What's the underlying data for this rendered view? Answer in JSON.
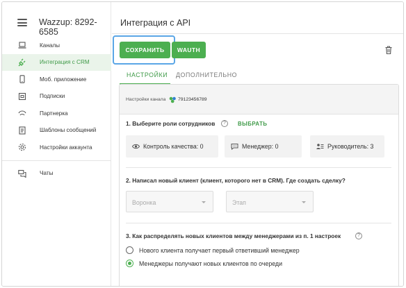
{
  "sidebar": {
    "title": "Wazzup: 8292-6585",
    "items": [
      {
        "label": "Каналы",
        "icon": "laptop-icon"
      },
      {
        "label": "Интеграция с CRM",
        "icon": "plug-icon",
        "active": true
      },
      {
        "label": "Моб. приложение",
        "icon": "phone-icon"
      },
      {
        "label": "Подписки",
        "icon": "wallet-icon"
      },
      {
        "label": "Партнерка",
        "icon": "handshake-icon"
      },
      {
        "label": "Шаблоны сообщений",
        "icon": "document-icon"
      },
      {
        "label": "Настройки аккаунта",
        "icon": "gear-icon"
      }
    ],
    "chats_label": "Чаты"
  },
  "main": {
    "title": "Интеграция с API",
    "toolbar": {
      "save_label": "СОХРАНИТЬ",
      "wauth_label": "WAUTH"
    },
    "tabs": [
      {
        "label": "НАСТРОЙКИ",
        "active": true
      },
      {
        "label": "ДОПОЛНИТЕЛЬНО",
        "active": false
      }
    ],
    "channel": {
      "label": "Настройки канала",
      "phone": "79123456789"
    },
    "section1": {
      "title": "1. Выберите роли сотрудников",
      "select_label": "ВЫБРАТЬ",
      "roles": [
        {
          "label": "Контроль качества: 0",
          "icon": "eye-icon"
        },
        {
          "label": "Менеджер: 0",
          "icon": "chat-icon"
        },
        {
          "label": "Руководитель: 3",
          "icon": "team-icon"
        }
      ]
    },
    "section2": {
      "title": "2. Написал новый клиент (клиент, которого нет в CRM). Где создать сделку?",
      "funnel_placeholder": "Воронка",
      "stage_placeholder": "Этап"
    },
    "section3": {
      "title": "3. Как распределять новых клиентов между менеджерами из п. 1 настроек",
      "options": [
        {
          "label": "Нового клиента получает первый ответивший менеджер",
          "selected": false
        },
        {
          "label": "Менеджеры получают новых клиентов по очереди",
          "selected": true
        }
      ]
    }
  },
  "colors": {
    "accent": "#4caf50",
    "focus": "#5aa6e6",
    "active_bg": "#eaf4ea"
  }
}
